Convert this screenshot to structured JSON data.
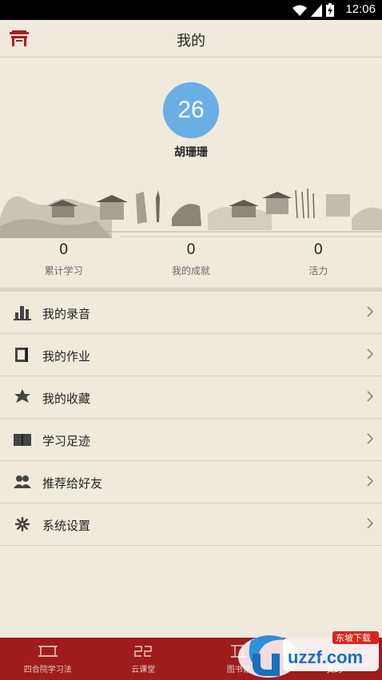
{
  "status_bar": {
    "time": "12:06"
  },
  "header": {
    "title": "我的"
  },
  "profile": {
    "avatar_text": "26",
    "username": "胡珊珊"
  },
  "stats": [
    {
      "value": "0",
      "label": "累计学习"
    },
    {
      "value": "0",
      "label": "我的成就"
    },
    {
      "value": "0",
      "label": "活力"
    }
  ],
  "menu": [
    {
      "label": "我的录音",
      "icon": "audio-icon"
    },
    {
      "label": "我的作业",
      "icon": "book-icon"
    },
    {
      "label": "我的收藏",
      "icon": "star-icon"
    },
    {
      "label": "学习足迹",
      "icon": "open-book-icon"
    },
    {
      "label": "推荐给好友",
      "icon": "users-icon"
    },
    {
      "label": "系统设置",
      "icon": "gear-icon"
    }
  ],
  "tabs": [
    {
      "label": "四合院学习法"
    },
    {
      "label": "云课堂"
    },
    {
      "label": "图书馆"
    },
    {
      "label": "我的"
    }
  ],
  "watermark": {
    "text": "uzzf.com",
    "sub": "东坡下载"
  },
  "colors": {
    "background": "#efeadc",
    "accent": "#9e1c1c",
    "avatar": "#6aaee6"
  }
}
